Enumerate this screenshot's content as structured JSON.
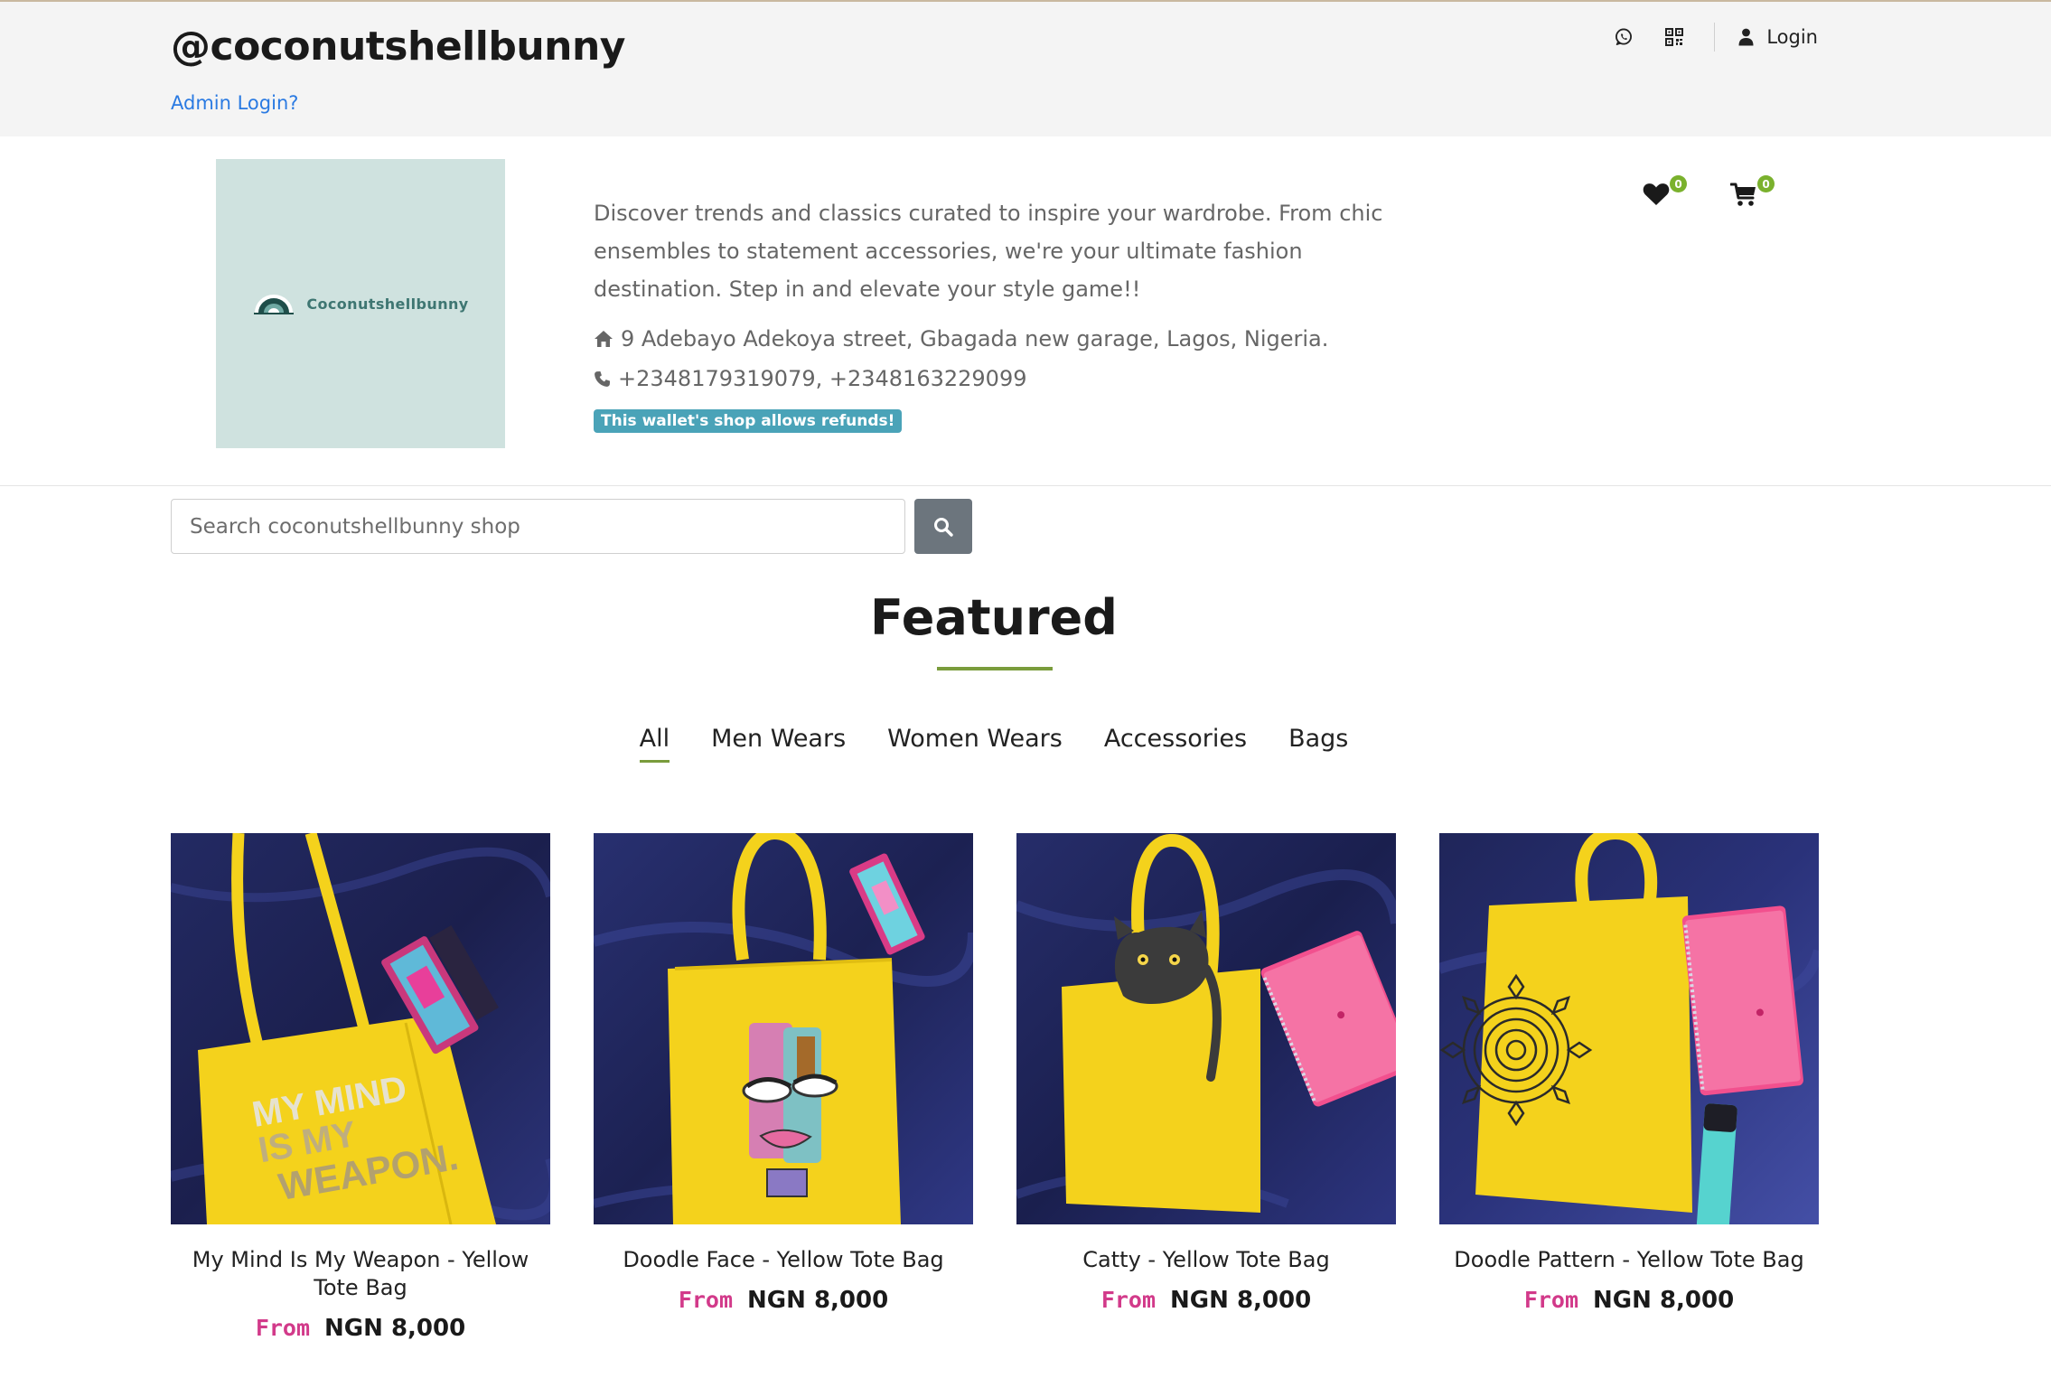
{
  "header": {
    "shop_handle": "@coconutshellbunny",
    "admin_link": "Admin Login?",
    "login_label": "Login",
    "icons": [
      "whatsapp-icon",
      "qr-code-icon",
      "user-icon"
    ]
  },
  "profile": {
    "logo_text": "Coconutshellbunny",
    "description": "Discover trends and classics curated to inspire your wardrobe. From chic ensembles to statement accessories, we're your ultimate fashion destination. Step in and elevate your style game!!",
    "address": "9 Adebayo Adekoya street, Gbagada new garage, Lagos, Nigeria.",
    "phone": "+2348179319079, +2348163229099",
    "refund_badge": "This wallet's shop allows refunds!",
    "wishlist_count": "0",
    "cart_count": "0"
  },
  "search": {
    "placeholder": "Search coconutshellbunny shop"
  },
  "featured": {
    "title": "Featured",
    "tabs": [
      {
        "label": "All",
        "active": true
      },
      {
        "label": "Men Wears",
        "active": false
      },
      {
        "label": "Women Wears",
        "active": false
      },
      {
        "label": "Accessories",
        "active": false
      },
      {
        "label": "Bags",
        "active": false
      }
    ]
  },
  "products": [
    {
      "name": "My Mind Is My Weapon - Yellow Tote Bag",
      "from": "From",
      "price": "NGN 8,000",
      "bag_print": [
        "MY MIND",
        "IS MY",
        "WEAPON."
      ]
    },
    {
      "name": "Doodle Face - Yellow Tote Bag",
      "from": "From",
      "price": "NGN 8,000"
    },
    {
      "name": "Catty - Yellow Tote Bag",
      "from": "From",
      "price": "NGN 8,000"
    },
    {
      "name": "Doodle Pattern - Yellow Tote Bag",
      "from": "From",
      "price": "NGN 8,000"
    }
  ],
  "colors": {
    "accent_green": "#7a9c3c",
    "link_blue": "#2a7ae2",
    "badge_teal": "#4aa3b8",
    "price_pink": "#d23a8a",
    "tote_yellow": "#f4d21c",
    "fabric_navy": "#1c2150"
  }
}
